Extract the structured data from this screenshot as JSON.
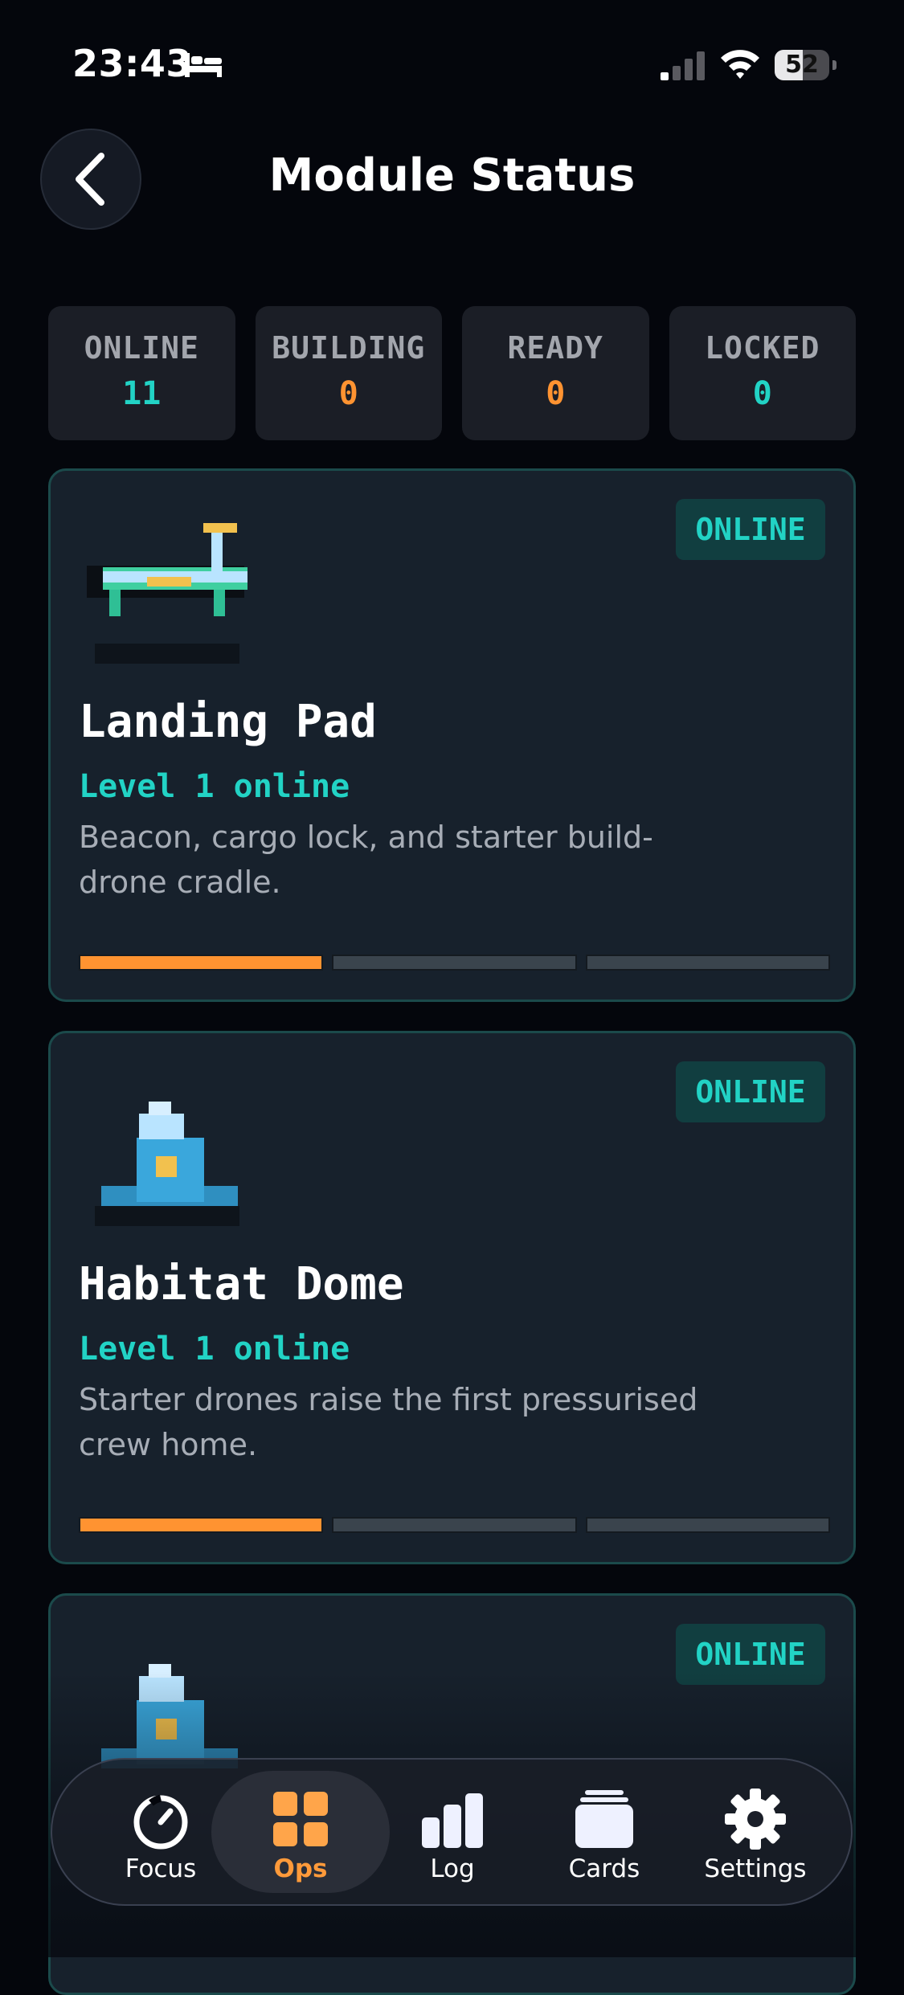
{
  "status_bar": {
    "time": "23:43",
    "battery": "52",
    "battery_level": 0.52,
    "icons": [
      "bed-icon",
      "signal-icon",
      "wifi-icon",
      "battery-icon"
    ]
  },
  "header": {
    "title": "Module Status",
    "back_icon": "chevron-left-icon"
  },
  "summary": [
    {
      "label": "ONLINE",
      "value": "11",
      "color": "#22d3c5"
    },
    {
      "label": "BUILDING",
      "value": "0",
      "color": "#ff9331"
    },
    {
      "label": "READY",
      "value": "0",
      "color": "#ff9331"
    },
    {
      "label": "LOCKED",
      "value": "0",
      "color": "#22d3c5"
    }
  ],
  "modules": [
    {
      "icon": "landing-pad-icon",
      "badge": "ONLINE",
      "name": "Landing Pad",
      "level": "Level 1 online",
      "description": "Beacon, cargo lock, and starter build-drone cradle.",
      "progress_filled": 1,
      "progress_total": 3
    },
    {
      "icon": "habitat-dome-icon",
      "badge": "ONLINE",
      "name": "Habitat Dome",
      "level": "Level 1 online",
      "description": "Starter drones raise the first pressurised crew home.",
      "progress_filled": 1,
      "progress_total": 3
    },
    {
      "icon": "habitat-dome-icon",
      "badge": "ONLINE"
    }
  ],
  "tabs": [
    {
      "label": "Focus",
      "icon": "timer-icon",
      "active": false
    },
    {
      "label": "Ops",
      "icon": "grid-icon",
      "active": true
    },
    {
      "label": "Log",
      "icon": "bar-chart-icon",
      "active": false
    },
    {
      "label": "Cards",
      "icon": "cards-icon",
      "active": false
    },
    {
      "label": "Settings",
      "icon": "gear-icon",
      "active": false
    }
  ],
  "colors": {
    "accent_teal": "#22d3c5",
    "accent_orange": "#ff9331",
    "background": "#04060c",
    "card": "#17212c"
  }
}
